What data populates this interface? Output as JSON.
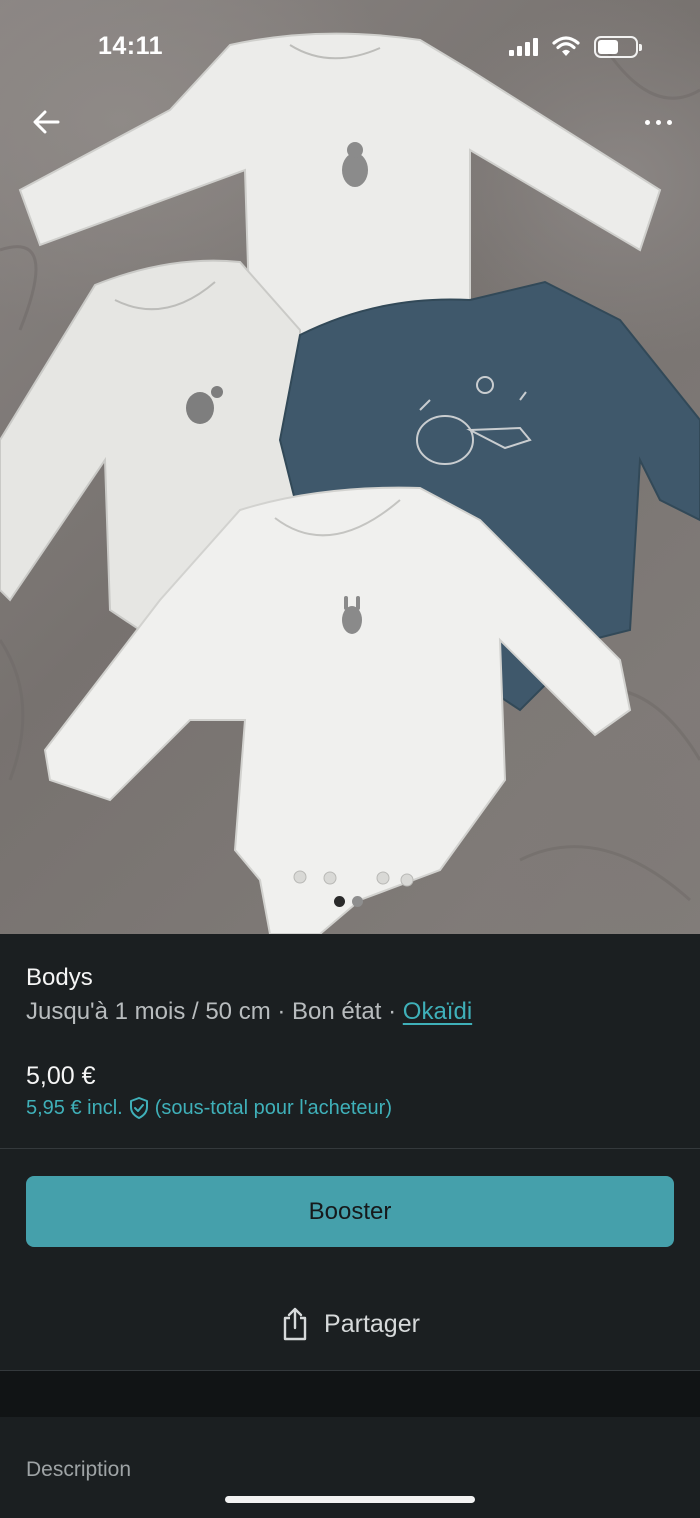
{
  "status_bar": {
    "time": "14:11",
    "battery_level": 0.55
  },
  "photo": {
    "pager": {
      "count": 2,
      "active_index": 0
    }
  },
  "item": {
    "title": "Bodys",
    "size": "Jusqu'à 1 mois / 50 cm",
    "separator": "·",
    "condition": "Bon état",
    "brand": "Okaïdi",
    "price": "5,00 €",
    "price_incl_amount": "5,95 € incl.",
    "price_incl_note": "(sous-total pour l'acheteur)"
  },
  "actions": {
    "booster_label": "Booster",
    "share_label": "Partager"
  },
  "sections": {
    "description_label": "Description"
  },
  "colors": {
    "accent": "#45a0ab",
    "link": "#3fb0b9",
    "background": "#1b1f21"
  },
  "icons": {
    "back": "arrow-left-icon",
    "more": "more-horizontal-icon",
    "share": "share-icon",
    "protection": "shield-check-icon"
  }
}
